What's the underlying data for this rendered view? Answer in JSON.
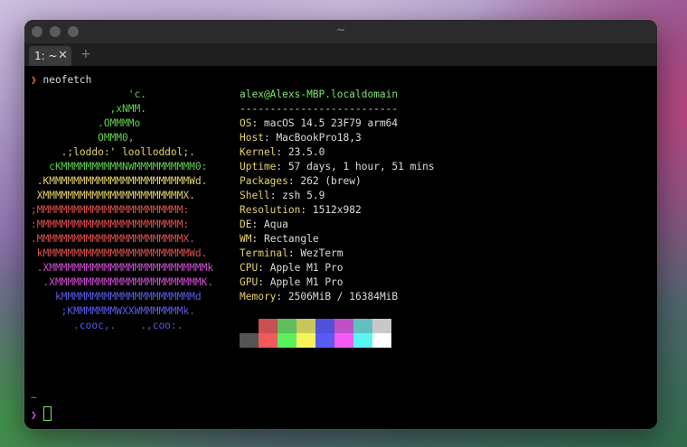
{
  "window": {
    "title": "~"
  },
  "tabs": [
    {
      "label": "1: ~",
      "close": "✕"
    }
  ],
  "new_tab": "+",
  "command": {
    "prompt": "❯",
    "text": "neofetch"
  },
  "ascii_art": [
    {
      "text": "                'c.",
      "color": "#61d04f"
    },
    {
      "text": "             ,xNMM.",
      "color": "#61d04f"
    },
    {
      "text": "           .OMMMMo",
      "color": "#61d04f"
    },
    {
      "text": "           OMMM0,",
      "color": "#61d04f"
    },
    {
      "text": "     .;loddo:' loolloddol;.",
      "color": "#e5d36a"
    },
    {
      "text": "   cKMMMMMMMMMMNWMMMMMMMMMM0:",
      "color": "#61d04f"
    },
    {
      "text": " .KMMMMMMMMMMMMMMMMMMMMMMMWd.",
      "color": "#e5d36a"
    },
    {
      "text": " XMMMMMMMMMMMMMMMMMMMMMMMX.",
      "color": "#e5d36a"
    },
    {
      "text": ";MMMMMMMMMMMMMMMMMMMMMMMM:",
      "color": "#e05050"
    },
    {
      "text": ":MMMMMMMMMMMMMMMMMMMMMMMM:",
      "color": "#e05050"
    },
    {
      "text": ".MMMMMMMMMMMMMMMMMMMMMMMMX.",
      "color": "#e05050"
    },
    {
      "text": " kMMMMMMMMMMMMMMMMMMMMMMMMWd.",
      "color": "#e05050"
    },
    {
      "text": " .XMMMMMMMMMMMMMMMMMMMMMMMMMMk",
      "color": "#d24fd6"
    },
    {
      "text": "  .XMMMMMMMMMMMMMMMMMMMMMMMMK.",
      "color": "#d24fd6"
    },
    {
      "text": "    kMMMMMMMMMMMMMMMMMMMMMMd",
      "color": "#5a5ae8"
    },
    {
      "text": "     ;KMMMMMMMWXXWMMMMMMMk.",
      "color": "#5a5ae8"
    },
    {
      "text": "       .cooc,.    .,coo:.",
      "color": "#5a5ae8"
    }
  ],
  "info": {
    "userhost": "alex@Alexs-MBP.localdomain",
    "separator": "--------------------------",
    "rows": [
      {
        "key": "OS",
        "value": "macOS 14.5 23F79 arm64"
      },
      {
        "key": "Host",
        "value": "MacBookPro18,3"
      },
      {
        "key": "Kernel",
        "value": "23.5.0"
      },
      {
        "key": "Uptime",
        "value": "57 days, 1 hour, 51 mins"
      },
      {
        "key": "Packages",
        "value": "262 (brew)"
      },
      {
        "key": "Shell",
        "value": "zsh 5.9"
      },
      {
        "key": "Resolution",
        "value": "1512x982"
      },
      {
        "key": "DE",
        "value": "Aqua"
      },
      {
        "key": "WM",
        "value": "Rectangle"
      },
      {
        "key": "Terminal",
        "value": "WezTerm"
      },
      {
        "key": "CPU",
        "value": "Apple M1 Pro"
      },
      {
        "key": "GPU",
        "value": "Apple M1 Pro"
      },
      {
        "key": "Memory",
        "value": "2506MiB / 16384MiB"
      }
    ]
  },
  "palette": {
    "normal": [
      "#000000",
      "#c85050",
      "#5cc05c",
      "#c8c85a",
      "#5050d8",
      "#c050c8",
      "#60c0c0",
      "#c8c8c8"
    ],
    "bright": [
      "#555555",
      "#f05a5a",
      "#5af05a",
      "#f5f55a",
      "#5a5af5",
      "#f55af5",
      "#5af5f5",
      "#ffffff"
    ]
  },
  "prompt2": {
    "dir": "~",
    "arrow": "❯"
  }
}
